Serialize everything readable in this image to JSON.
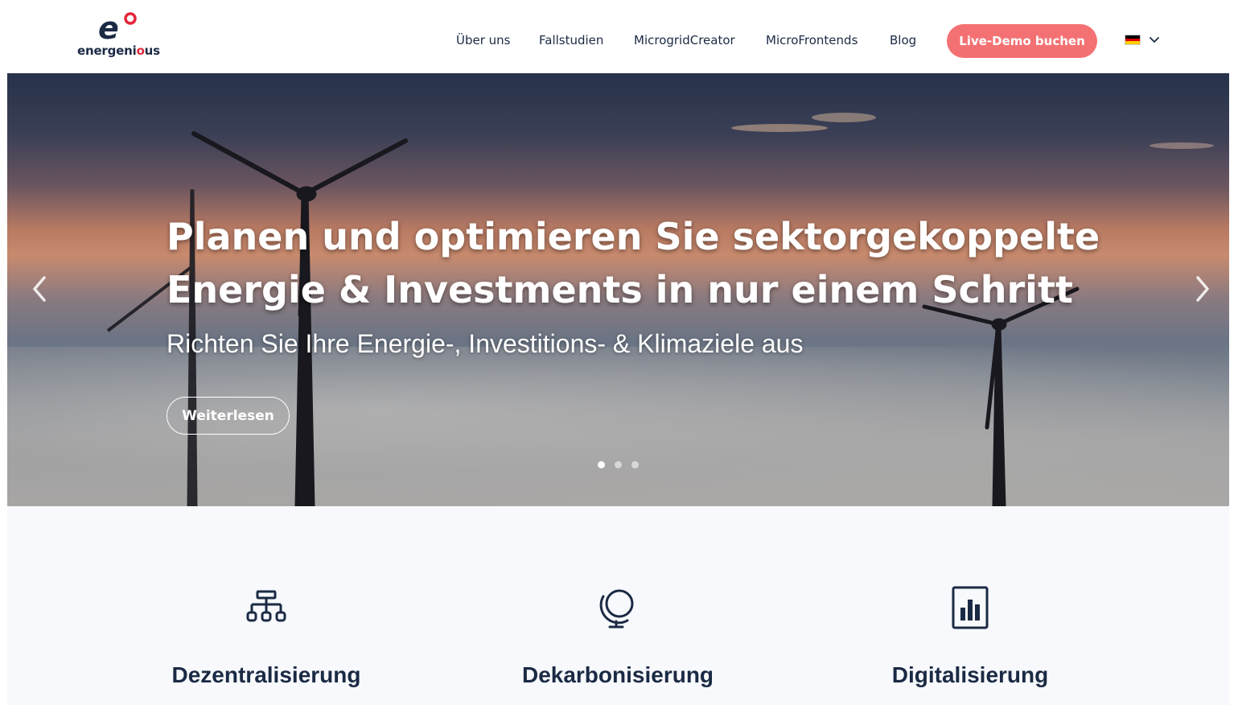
{
  "header": {
    "logo": {
      "text_before": "energeni",
      "text_accent": "o",
      "text_after": "us"
    },
    "nav": [
      {
        "label": "Über uns"
      },
      {
        "label": "Fallstudien"
      },
      {
        "label": "MicrogridCreator"
      },
      {
        "label": "MicroFrontends"
      },
      {
        "label": "Blog"
      }
    ],
    "cta_label": "Live-Demo buchen",
    "language": {
      "flag": "de-flag",
      "icon": "chevron-down-icon"
    }
  },
  "hero": {
    "title_line1": "Planen und optimieren Sie sektorgekoppelte",
    "title_line2": "Energie & Investments in nur einem Schritt",
    "subtitle": "Richten Sie Ihre Energie-, Investitions- & Klimaziele aus",
    "button_label": "Weiterlesen",
    "slides_total": 3,
    "active_slide": 1,
    "prev_icon": "chevron-left-icon",
    "next_icon": "chevron-right-icon"
  },
  "features": [
    {
      "icon": "sitemap-icon",
      "title": "Dezentralisierung"
    },
    {
      "icon": "globe-icon",
      "title": "Dekarbonisierung"
    },
    {
      "icon": "bar-chart-icon",
      "title": "Digitalisierung"
    }
  ],
  "colors": {
    "brand_navy": "#1b2a44",
    "brand_red": "#e3263a",
    "cta": "#f47173",
    "features_bg": "#f7f9fc"
  }
}
